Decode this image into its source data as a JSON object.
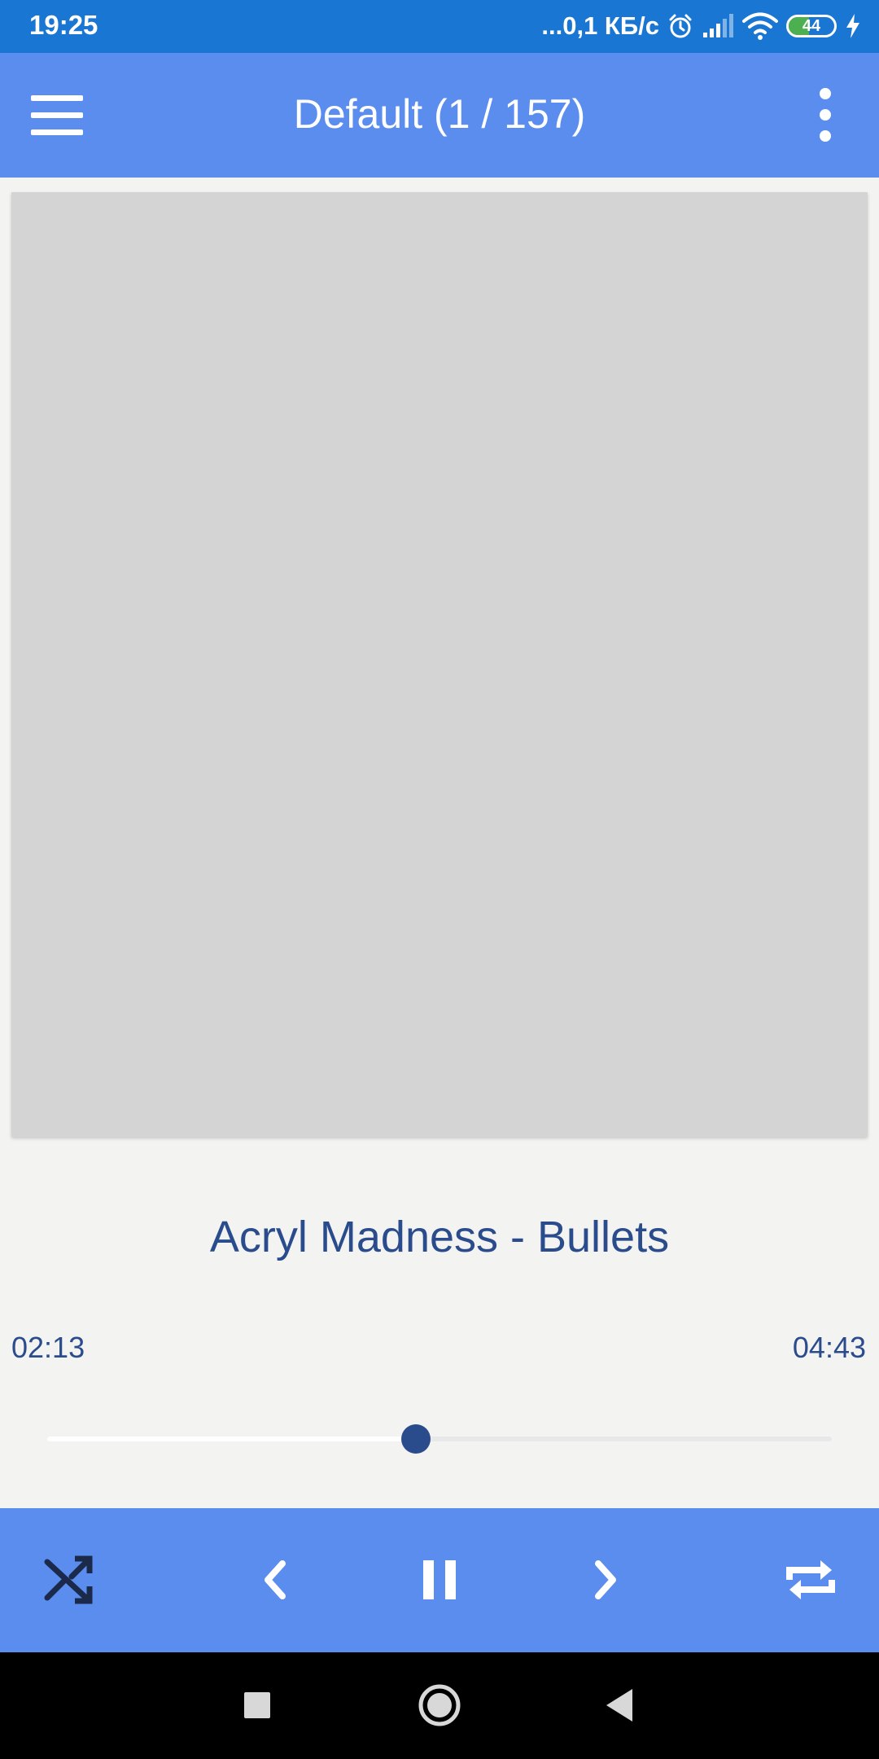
{
  "status_bar": {
    "time": "19:25",
    "network_speed": "...0,1 КБ/с",
    "battery_level": "44",
    "battery_fraction": 0.44,
    "icons": [
      "alarm-icon",
      "signal-icon",
      "wifi-icon",
      "battery-icon",
      "charging-icon"
    ]
  },
  "app_bar": {
    "title": "Default (1 / 157)",
    "menu_icon": "hamburger-menu-icon",
    "more_icon": "more-vertical-icon"
  },
  "player": {
    "track_title": "Acryl Madness - Bullets",
    "elapsed": "02:13",
    "total": "04:43",
    "progress_fraction": 0.47
  },
  "controls": {
    "icons": [
      "shuffle-icon",
      "previous-icon",
      "pause-icon",
      "next-icon",
      "repeat-icon"
    ]
  },
  "nav_bar": {
    "icons": [
      "recents-square-icon",
      "home-circle-icon",
      "back-triangle-icon"
    ]
  },
  "colors": {
    "status_bar": "#1976d2",
    "app_bar": "#5b8def",
    "accent_text": "#2b4c8c",
    "background": "#f3f3f2",
    "album_placeholder": "#d4d4d4",
    "battery_green": "#4caf50"
  }
}
